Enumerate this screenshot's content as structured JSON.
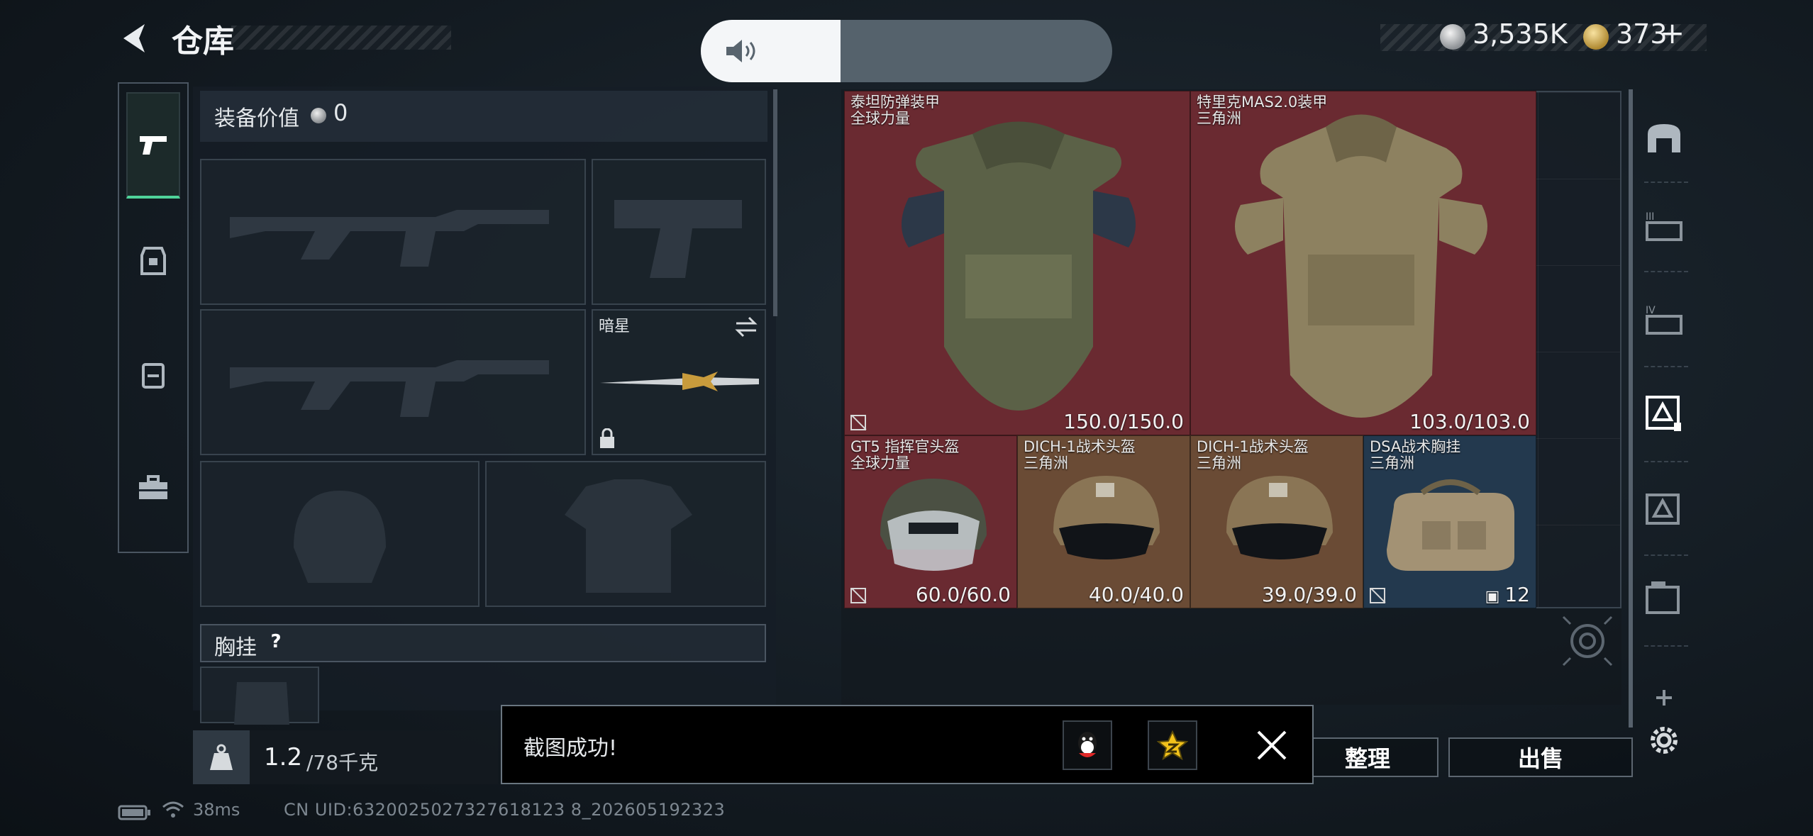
{
  "header": {
    "back_icon": "back-arrow-icon",
    "title": "仓库",
    "currency1_value": "3,535K",
    "currency2_value": "373",
    "currency2_add": "+"
  },
  "volume": {
    "icon": "speaker-icon",
    "level": 0.34
  },
  "equip": {
    "value_label": "装备价值",
    "value_amount": "0",
    "melee_name": "暗星",
    "chest_label": "胸挂",
    "chest_help": "?"
  },
  "weight": {
    "value": "1.2",
    "capacity": "/78千克"
  },
  "stash": {
    "items": [
      {
        "name": "泰坦防弹装甲",
        "origin": "全球力量",
        "durability": "150.0/150.0"
      },
      {
        "name": "特里克MAS2.0装甲",
        "origin": "三角洲",
        "durability": "103.0/103.0"
      },
      {
        "name": "GT5 指挥官头盔",
        "origin": "全球力量",
        "durability": "60.0/60.0"
      },
      {
        "name": "DICH-1战术头盔",
        "origin": "三角洲",
        "durability": "40.0/40.0"
      },
      {
        "name": "DICH-1战术头盔",
        "origin": "三角洲",
        "durability": "39.0/39.0"
      },
      {
        "name": "DSA战术胸挂",
        "origin": "三角洲",
        "capacity": "12"
      }
    ]
  },
  "actions": {
    "sort_label": "整理",
    "sell_label": "出售"
  },
  "toast": {
    "message": "截图成功!",
    "share1": "qq-icon",
    "share2": "star-share-icon"
  },
  "status": {
    "latency": "38ms",
    "uid": "CN UID:6320025027327618123 8_202605192323"
  },
  "colors": {
    "red_cell": "#6e2a30",
    "brown_cell": "#6b4c35",
    "blue_cell": "#253c52",
    "accent_green": "#4fd39a"
  }
}
